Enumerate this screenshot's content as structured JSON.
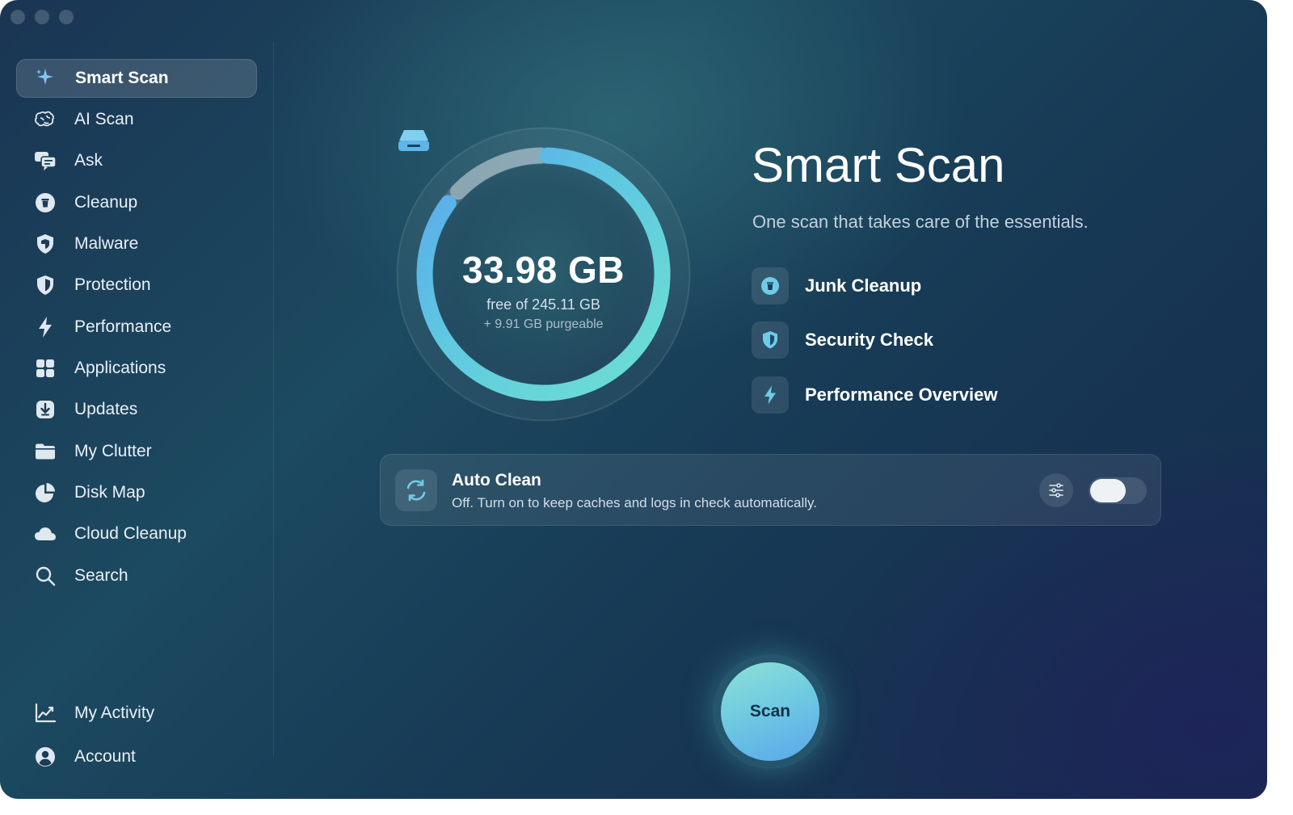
{
  "sidebar": {
    "items": [
      {
        "label": "Smart Scan",
        "icon": "sparkles-icon",
        "active": true
      },
      {
        "label": "AI Scan",
        "icon": "brain-icon"
      },
      {
        "label": "Ask",
        "icon": "chat-bubbles-icon"
      },
      {
        "label": "Cleanup",
        "icon": "trash-icon"
      },
      {
        "label": "Malware",
        "icon": "shield-half-icon"
      },
      {
        "label": "Protection",
        "icon": "shield-icon"
      },
      {
        "label": "Performance",
        "icon": "lightning-icon"
      },
      {
        "label": "Applications",
        "icon": "grid-icon"
      },
      {
        "label": "Updates",
        "icon": "download-icon"
      },
      {
        "label": "My Clutter",
        "icon": "folder-icon"
      },
      {
        "label": "Disk Map",
        "icon": "pie-icon"
      },
      {
        "label": "Cloud Cleanup",
        "icon": "cloud-icon"
      },
      {
        "label": "Search",
        "icon": "magnifier-icon"
      }
    ],
    "footer": [
      {
        "label": "My Activity",
        "icon": "chart-line-icon"
      },
      {
        "label": "Account",
        "icon": "person-icon"
      }
    ]
  },
  "storage": {
    "free_value": "33.98 GB",
    "free_caption": "free of 245.11 GB",
    "purgeable_caption": "+ 9.91 GB purgeable",
    "free_fraction": 0.1386
  },
  "main": {
    "title": "Smart Scan",
    "subtitle": "One scan that takes care of the essentials.",
    "features": [
      {
        "label": "Junk Cleanup",
        "icon": "trash-icon"
      },
      {
        "label": "Security Check",
        "icon": "shield-icon"
      },
      {
        "label": "Performance Overview",
        "icon": "lightning-icon"
      }
    ]
  },
  "auto_clean": {
    "title": "Auto Clean",
    "description": "Off. Turn on to keep caches and logs in check automatically.",
    "enabled": false
  },
  "scan_button": {
    "label": "Scan"
  },
  "colors": {
    "accent_teal": "#5fd3d0",
    "accent_blue": "#5aa6ec"
  }
}
